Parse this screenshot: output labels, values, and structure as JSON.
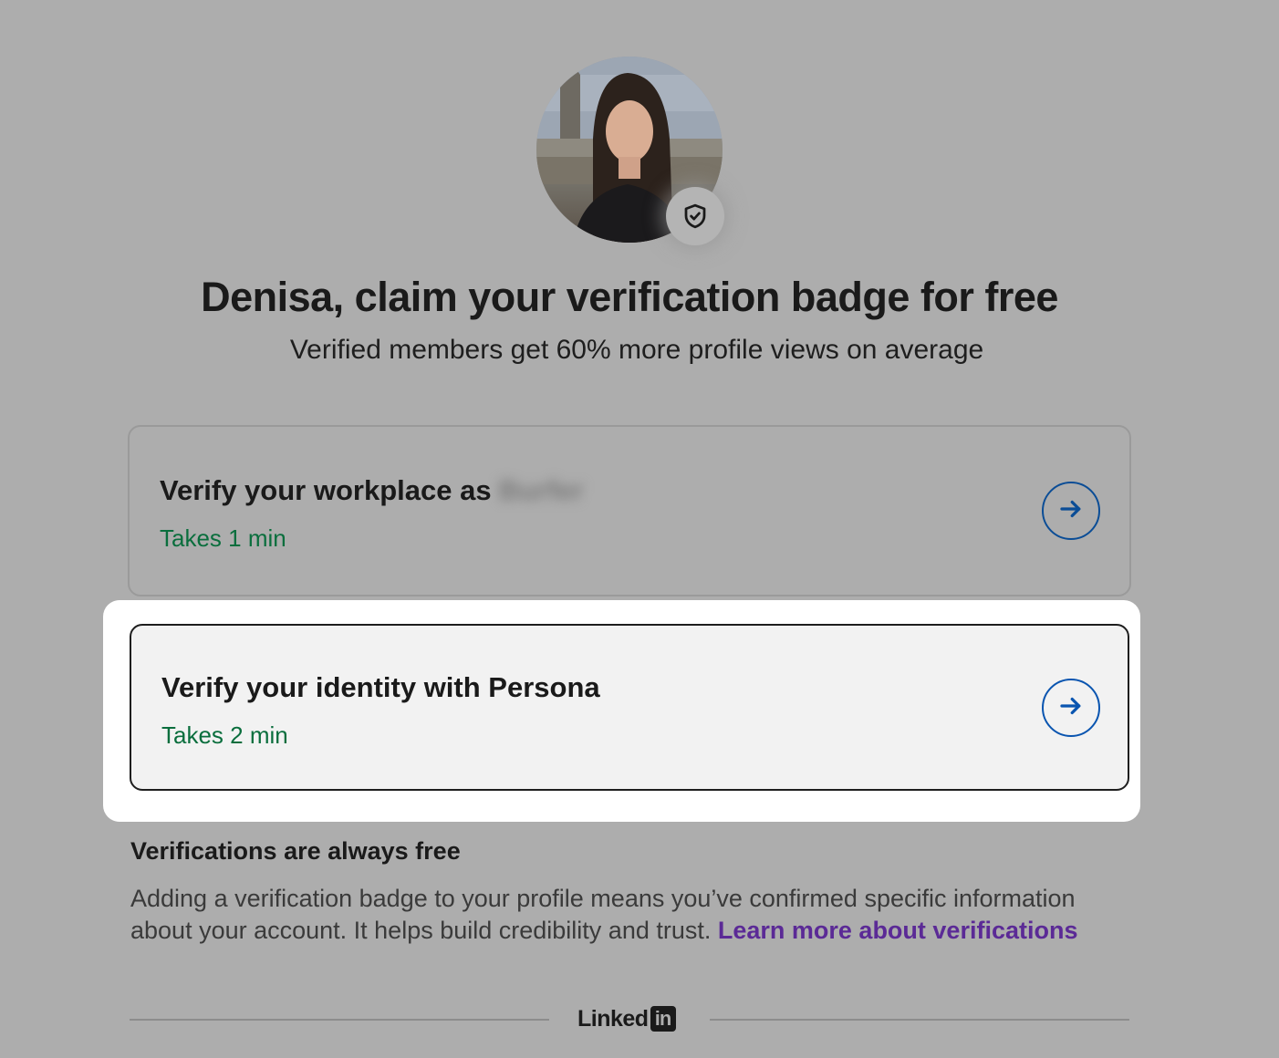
{
  "profile": {
    "avatar_icon": "profile-photo",
    "badge_icon": "shield-check-icon"
  },
  "header": {
    "title": "Denisa, claim your verification badge for free",
    "subtitle": "Verified members get 60% more profile views on average"
  },
  "options": [
    {
      "title": "Verify your workplace as",
      "company": "Burfer",
      "duration": "Takes 1 min",
      "icon": "arrow-right-icon"
    },
    {
      "title": "Verify your identity with Persona",
      "duration": "Takes 2 min",
      "icon": "arrow-right-icon"
    }
  ],
  "info": {
    "title": "Verifications are always free",
    "body": "Adding a verification badge to your profile means you’ve confirmed specific information about your account. It helps build credibility and trust. ",
    "link": "Learn more about verifications"
  },
  "footer": {
    "brand_text": "Linked",
    "brand_box": "in"
  },
  "colors": {
    "overlay_bg": "#adadad",
    "link": "#5b2a96",
    "duration": "#0a6e3d",
    "arrow": "#0a55b0"
  }
}
